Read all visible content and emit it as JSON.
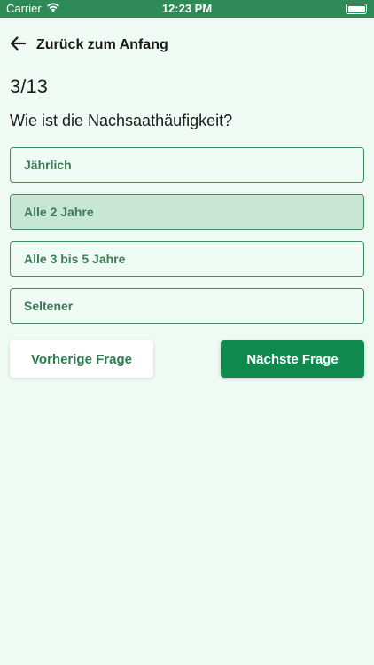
{
  "status_bar": {
    "carrier": "Carrier",
    "time": "12:23 PM",
    "wifi_icon": "wifi-icon",
    "battery_icon": "battery-icon",
    "battery_level": 1.0,
    "background_color": "#2e8b57"
  },
  "nav": {
    "back_icon": "arrow-left-icon",
    "back_label": "Zurück zum Anfang"
  },
  "quiz": {
    "counter": "3/13",
    "question": "Wie ist die Nachsaathäufigkeit?",
    "options": [
      {
        "label": "Jährlich",
        "selected": false
      },
      {
        "label": "Alle 2 Jahre",
        "selected": true
      },
      {
        "label": "Alle 3 bis 5 Jahre",
        "selected": false
      },
      {
        "label": "Seltener",
        "selected": false
      }
    ]
  },
  "buttons": {
    "previous_label": "Vorherige Frage",
    "next_label": "Nächste Frage"
  },
  "colors": {
    "page_background": "#f0faf5",
    "accent": "#0f8a4f",
    "option_border": "#3d8c5c",
    "option_selected_bg": "#c8e6d4",
    "option_text": "#3d7a55"
  }
}
